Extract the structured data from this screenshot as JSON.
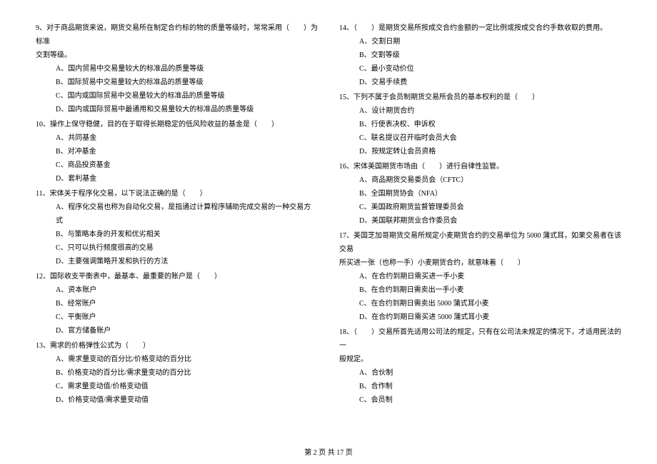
{
  "left": {
    "q9": {
      "stem1": "9、对于商品期货来说，期货交易所在制定合约标的物的质量等级时，常常采用（　　）为标准",
      "stem2": "交割等级。",
      "a": "A、国内贸易中交易量较大的标准品的质量等级",
      "b": "B、国际贸易中交易量较大的标准品的质量等级",
      "c": "C、国内或国际贸易中交易量较大的标准品的质量等级",
      "d": "D、国内或国际贸易中最通用和交易量较大的标准品的质量等级"
    },
    "q10": {
      "stem": "10、操作上保守稳健，目的在于取得长期稳定的低风险收益的基金是（　　）",
      "a": "A、共同基金",
      "b": "B、对冲基金",
      "c": "C、商品投资基金",
      "d": "D、套利基金"
    },
    "q11": {
      "stem": "11、宋体关于程序化交易，以下说法正确的是（　　）",
      "a": "A、程序化交易也称为自动化交易，是指通过计算程序辅助完成交易的一种交易方式",
      "b": "B、与策略本身的开发和优劣相关",
      "c": "C、只可以执行频度很高的交易",
      "d": "D、主要强调策略开发和执行的方法"
    },
    "q12": {
      "stem": "12、国际收支平衡表中，最基本、最重要的账户是（　　）",
      "a": "A、资本账户",
      "b": "B、经常账户",
      "c": "C、平衡账户",
      "d": "D、官方储备账户"
    },
    "q13": {
      "stem": "13、需求的价格弹性公式为（　　）",
      "a": "A、需求量变动的百分比/价格变动的百分比",
      "b": "B、价格变动的百分比/需求量变动的百分比",
      "c": "C、需求量变动值/价格变动值",
      "d": "D、价格变动值/需求量变动值"
    }
  },
  "right": {
    "q14": {
      "stem": "14、（　　）是期货交易所按成交合约金额的一定比例或按成交合约手数收取的费用。",
      "a": "A、交割日期",
      "b": "B、交割等级",
      "c": "C、最小变动价位",
      "d": "D、交易手续费"
    },
    "q15": {
      "stem": "15、下列不属于会员制期货交易所会员的基本权利的是（　　）",
      "a": "A、设计期货合约",
      "b": "B、行使表决权、申诉权",
      "c": "C、联名提议召开临时会员大会",
      "d": "D、按规定转让会员资格"
    },
    "q16": {
      "stem": "16、宋体美国期货市场由（　　）进行自律性监管。",
      "a": "A、商品期货交易委员会（CFTC）",
      "b": "B、全国期货协会（NFA）",
      "c": "C、美国政府期货监督管理委员会",
      "d": "D、美国联邦期货业合作委员会"
    },
    "q17": {
      "stem1": "17、美国芝加哥期货交易所规定小麦期货合约的交易单位为 5000 蒲式耳，如果交易者在该交易",
      "stem2": "所买进一张（也称一手）小麦期货合约，就意味着（　　）",
      "a": "A、在合约到期日需买进一手小麦",
      "b": "B、在合约到期日需卖出一手小麦",
      "c": "C、在合约到期日需卖出 5000 蒲式耳小麦",
      "d": "D、在合约到期日需买进 5000 蒲式耳小麦"
    },
    "q18": {
      "stem1": "18、（　　）交易所首先适用公司法的规定，只有在公司法未规定的情况下，才适用民法的一",
      "stem2": "般规定。",
      "a": "A、合伙制",
      "b": "B、合作制",
      "c": "C、会员制"
    }
  },
  "footer": "第 2 页 共 17 页"
}
